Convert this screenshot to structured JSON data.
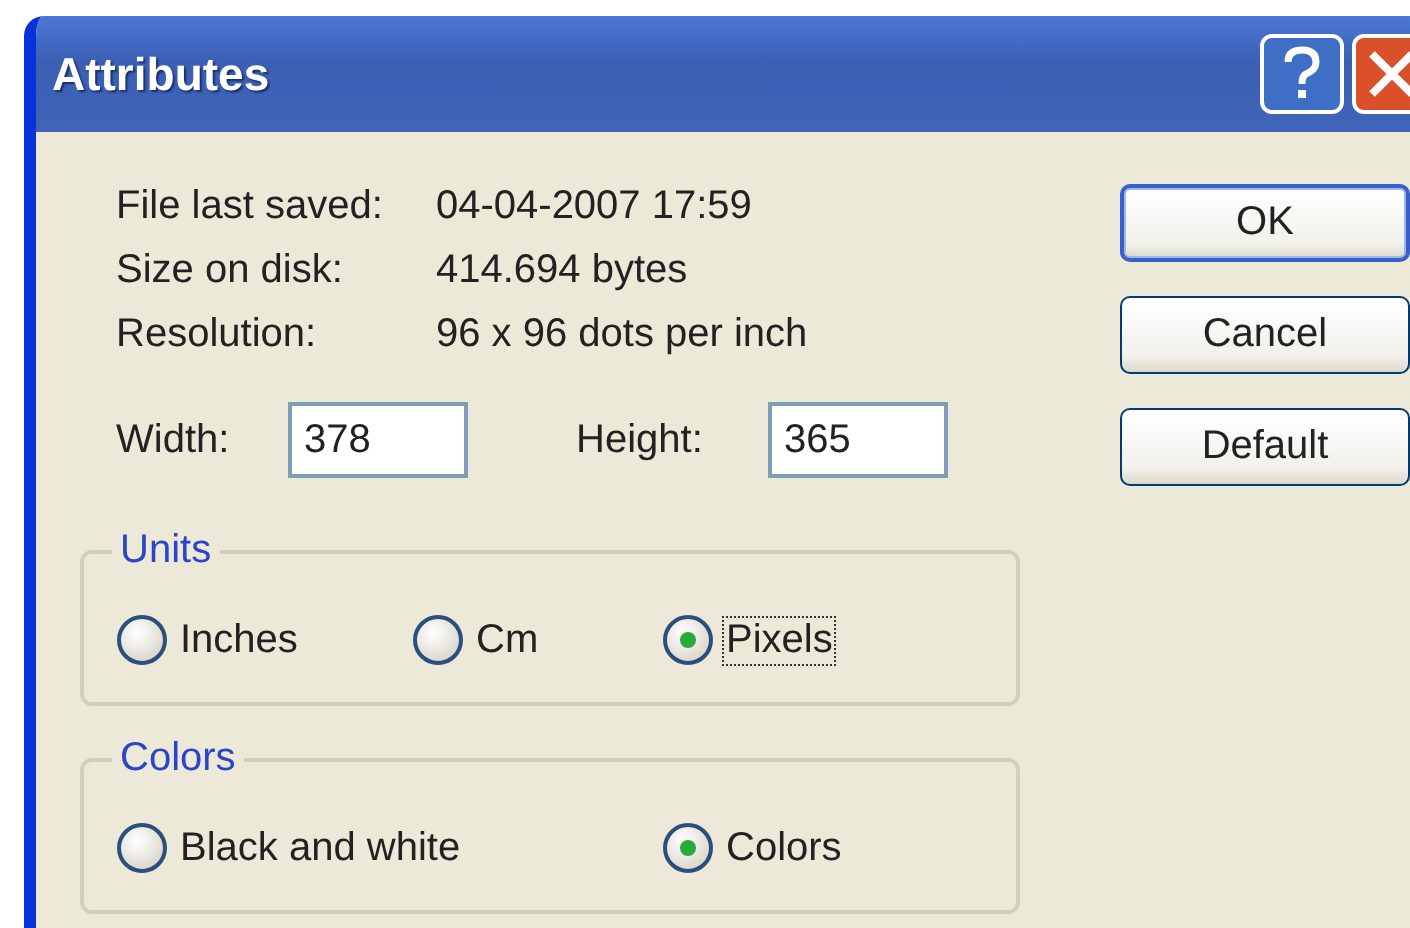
{
  "window": {
    "title": "Attributes"
  },
  "info": [
    {
      "label": "File last saved:",
      "value": "04-04-2007 17:59"
    },
    {
      "label": "Size on disk:",
      "value": "414.694 bytes"
    },
    {
      "label": "Resolution:",
      "value": "96 x 96 dots per inch"
    }
  ],
  "size_fields": [
    {
      "label": "Width:",
      "value": "378"
    },
    {
      "label": "Height:",
      "value": "365"
    }
  ],
  "groups": [
    {
      "title": "Units",
      "options": [
        {
          "label": "Inches",
          "selected": false,
          "focused": false
        },
        {
          "label": "Cm",
          "selected": false,
          "focused": false
        },
        {
          "label": "Pixels",
          "selected": true,
          "focused": true
        }
      ]
    },
    {
      "title": "Colors",
      "options": [
        {
          "label": "Black and white",
          "selected": false,
          "focused": false
        },
        {
          "label": "Colors",
          "selected": true,
          "focused": false
        }
      ]
    }
  ],
  "buttons": [
    {
      "label": "OK",
      "default": true
    },
    {
      "label": "Cancel",
      "default": false
    },
    {
      "label": "Default",
      "default": false
    }
  ]
}
